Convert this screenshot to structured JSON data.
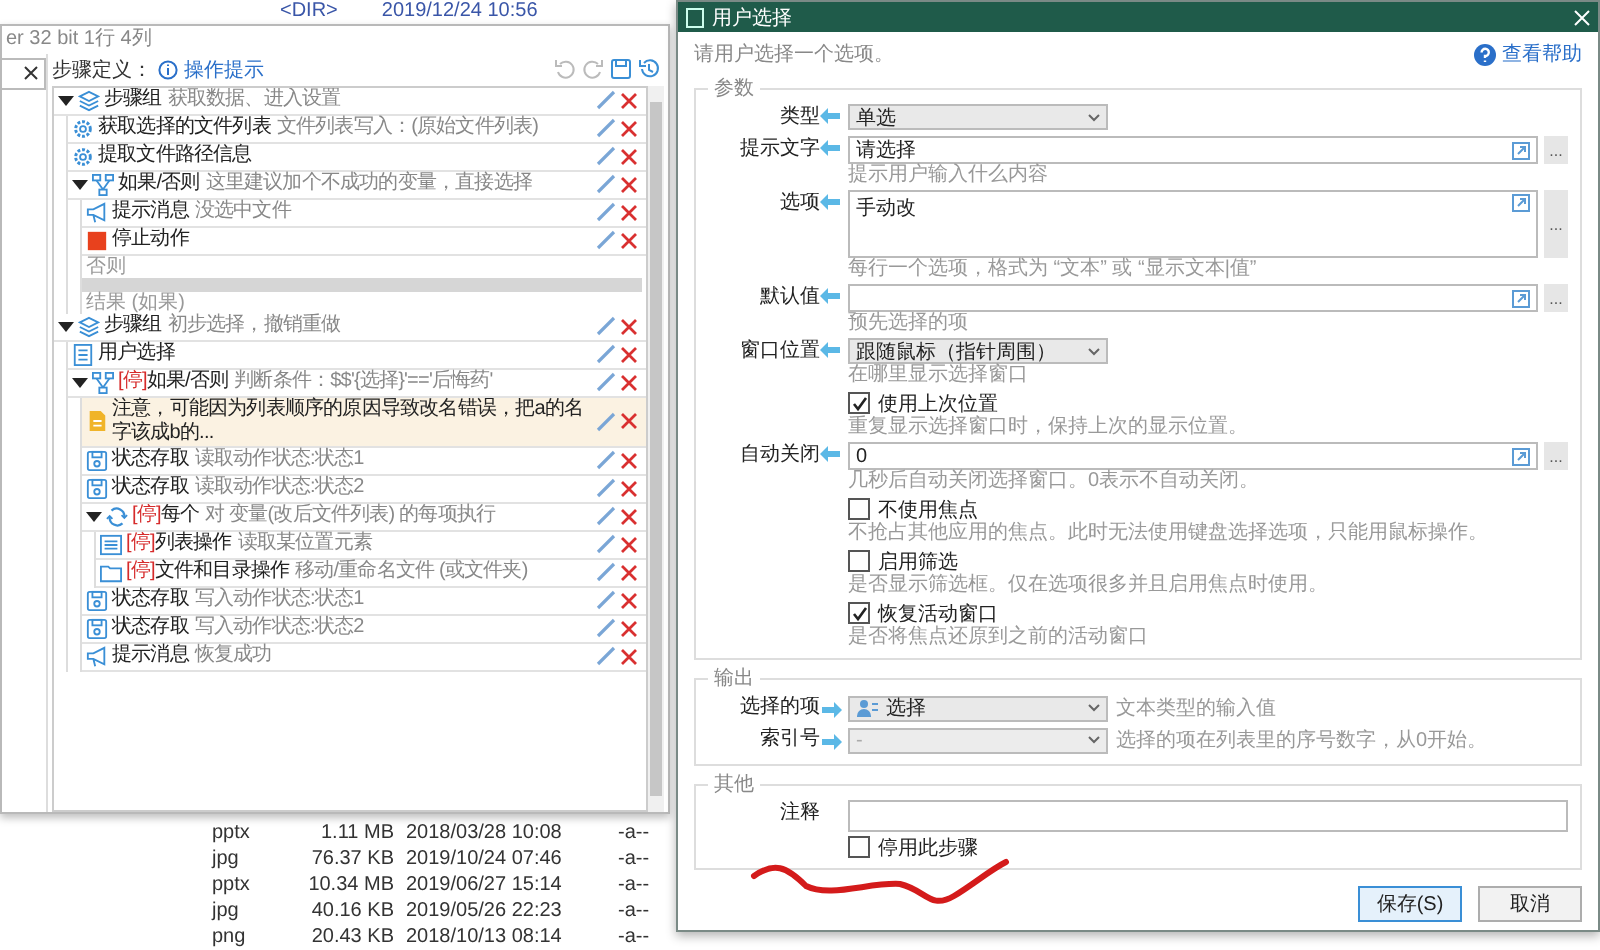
{
  "background_window": {
    "top_row": {
      "type": "<DIR>",
      "date": "2019/12/24 10:56"
    },
    "file_rows": [
      {
        "type": "pptx",
        "size": "1.11 MB",
        "date": "2018/03/28 10:08",
        "attr": "-a--"
      },
      {
        "type": "jpg",
        "size": "76.37 KB",
        "date": "2019/10/24 07:46",
        "attr": "-a--"
      },
      {
        "type": "pptx",
        "size": "10.34 MB",
        "date": "2019/06/27 15:14",
        "attr": "-a--"
      },
      {
        "type": "jpg",
        "size": "40.16 KB",
        "date": "2019/05/26 22:23",
        "attr": "-a--"
      },
      {
        "type": "png",
        "size": "20.43 KB",
        "date": "2018/10/13 08:14",
        "attr": "-a--"
      }
    ]
  },
  "editor": {
    "status_text": "er 32 bit 1行 4列",
    "toolbar_label": "步骤定义：",
    "hint_link": "操作提示",
    "steps": [
      {
        "kind": "group",
        "expanded": true,
        "title": "步骤组",
        "desc": "获取数据、进入设置",
        "children": [
          {
            "kind": "action",
            "title": "获取选择的文件列表",
            "desc": "文件列表写入：(原始文件列表)"
          },
          {
            "kind": "action",
            "title": "提取文件路径信息"
          },
          {
            "kind": "if",
            "expanded": true,
            "title": "如果/否则",
            "desc": "这里建议加个不成功的变量，直接选择",
            "else_label": "否则",
            "end_label": "结果 (如果)",
            "children": [
              {
                "kind": "message",
                "title": "提示消息",
                "desc": "没选中文件"
              },
              {
                "kind": "stop",
                "title": "停止动作"
              }
            ]
          }
        ]
      },
      {
        "kind": "group",
        "expanded": true,
        "title": "步骤组",
        "desc": "初步选择，撤销重做",
        "children": [
          {
            "kind": "form",
            "title": "用户选择"
          },
          {
            "kind": "if",
            "tag": "[停]",
            "expanded": true,
            "title": "如果/否则",
            "desc": "判断条件：$$'{选择}'=='后悔药'",
            "children": [
              {
                "kind": "note",
                "title": "注意，可能因为列表顺序的原因导致改名错误，把a的名字该成b的..."
              },
              {
                "kind": "state",
                "title": "状态存取",
                "desc": "读取动作状态:状态1"
              },
              {
                "kind": "state",
                "title": "状态存取",
                "desc": "读取动作状态:状态2"
              },
              {
                "kind": "loop",
                "tag": "[停]",
                "expanded": true,
                "title": "每个",
                "desc": "对 变量(改后文件列表) 的每项执行",
                "children": [
                  {
                    "kind": "list",
                    "tag": "[停]",
                    "title": "列表操作",
                    "desc": "读取某位置元素"
                  },
                  {
                    "kind": "folder",
                    "tag": "[停]",
                    "title": "文件和目录操作",
                    "desc": "移动/重命名文件 (或文件夹)"
                  }
                ]
              },
              {
                "kind": "state",
                "title": "状态存取",
                "desc": "写入动作状态:状态1"
              },
              {
                "kind": "state",
                "title": "状态存取",
                "desc": "写入动作状态:状态2"
              },
              {
                "kind": "message",
                "title": "提示消息",
                "desc": "恢复成功"
              }
            ]
          }
        ]
      }
    ]
  },
  "dialog": {
    "title": "用户选择",
    "description": "请用户选择一个选项。",
    "help_link": "查看帮助",
    "params": {
      "legend": "参数",
      "rows": [
        {
          "kind": "select",
          "label": "类型",
          "value": "单选"
        },
        {
          "kind": "input",
          "label": "提示文字",
          "value": "请选择",
          "hint": "提示用户输入什么内容",
          "button": "..."
        },
        {
          "kind": "textarea",
          "label": "选项",
          "value": "手动改",
          "hint": "每行一个选项，格式为 “文本” 或 “显示文本|值”",
          "button": "..."
        },
        {
          "kind": "input",
          "label": "默认值",
          "hint": "预先选择的项",
          "button": "..."
        },
        {
          "kind": "select",
          "label": "窗口位置",
          "value": "跟随鼠标（指针周围）",
          "hint": "在哪里显示选择窗口"
        },
        {
          "kind": "checkbox",
          "label": "使用上次位置",
          "checked": true,
          "hint": "重复显示选择窗口时，保持上次的显示位置。"
        },
        {
          "kind": "input",
          "label": "自动关闭",
          "value": "0",
          "hint": "几秒后自动关闭选择窗口。0表示不自动关闭。",
          "button": "..."
        },
        {
          "kind": "checkbox",
          "label": "不使用焦点",
          "checked": false,
          "hint": "不抢占其他应用的焦点。此时无法使用键盘选择选项，只能用鼠标操作。"
        },
        {
          "kind": "checkbox",
          "label": "启用筛选",
          "checked": false,
          "hint": "是否显示筛选框。仅在选项很多并且启用焦点时使用。"
        },
        {
          "kind": "checkbox",
          "label": "恢复活动窗口",
          "checked": true,
          "hint": "是否将焦点还原到之前的活动窗口"
        }
      ]
    },
    "output": {
      "legend": "输出",
      "rows": [
        {
          "label": "选择的项",
          "value": "选择",
          "disabled": false,
          "hint": "文本类型的输入值"
        },
        {
          "label": "索引号",
          "value": "-",
          "disabled": true,
          "hint": "选择的项在列表里的序号数字，从0开始。"
        }
      ]
    },
    "other": {
      "legend": "其他",
      "comment_label": "注释",
      "disable_step": {
        "label": "停用此步骤",
        "checked": false
      }
    },
    "buttons": [
      {
        "label": "保存(S)",
        "default": true
      },
      {
        "label": "取消",
        "default": false
      }
    ]
  }
}
